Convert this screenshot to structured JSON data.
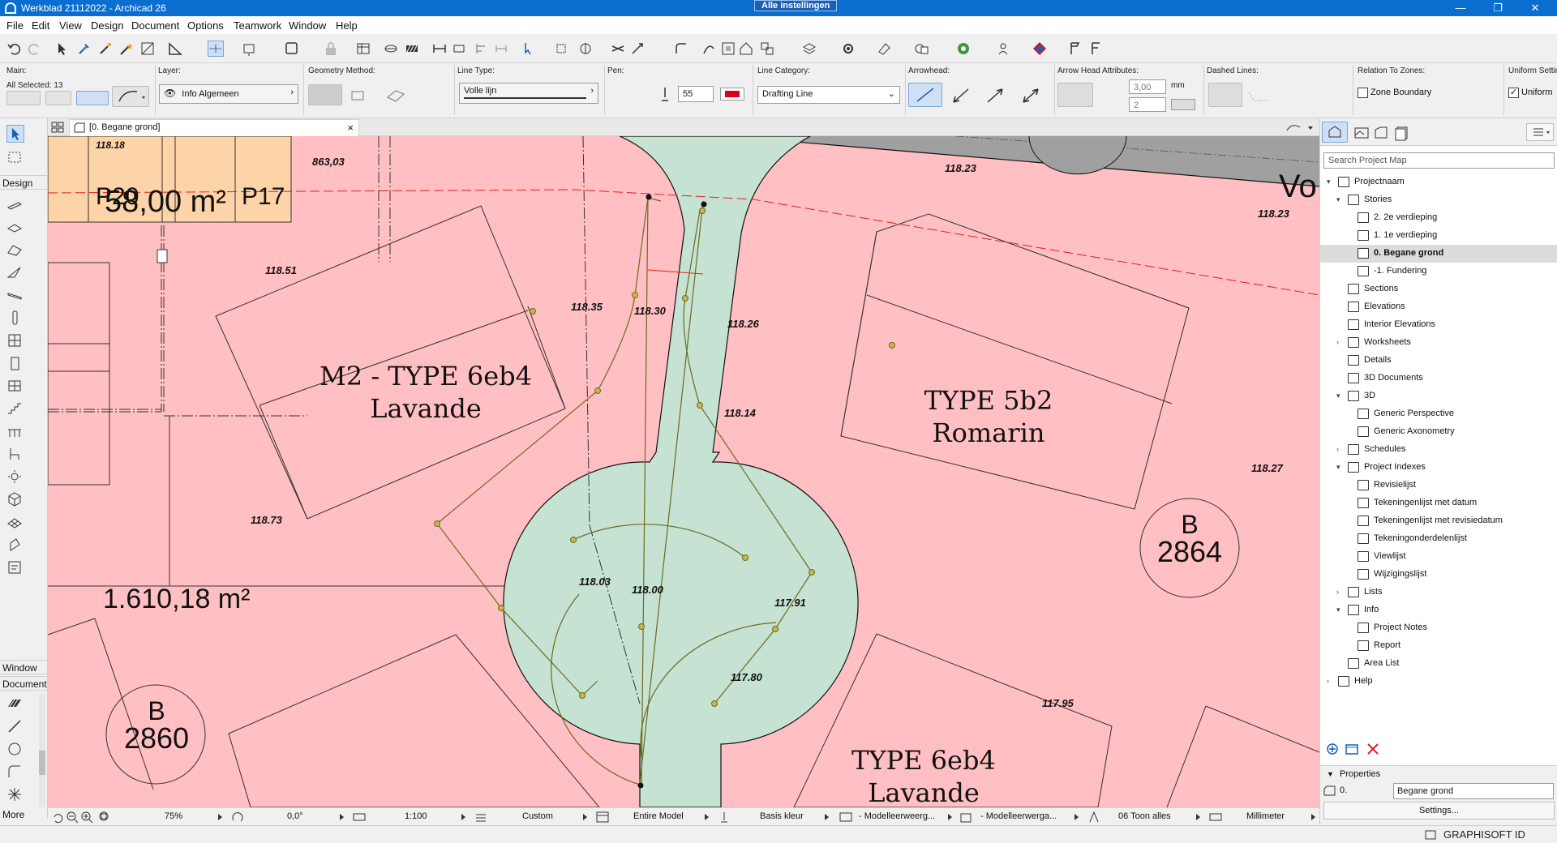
{
  "titlebar": {
    "title": "Werkblad 21112022 - Archicad 26",
    "settings_badge": "Alle instellingen",
    "minimize": "—",
    "maximize": "❐",
    "close": "✕"
  },
  "menu": [
    "File",
    "Edit",
    "View",
    "Design",
    "Document",
    "Options",
    "Teamwork",
    "Window",
    "Help"
  ],
  "infobox": {
    "main_label": "Main:",
    "all_selected": "All Selected: 13",
    "layer_label": "Layer:",
    "layer_value": "Info Algemeen",
    "geometry_label": "Geometry Method:",
    "linetype_label": "Line Type:",
    "linetype_value": "Volle lijn",
    "pen_label": "Pen:",
    "pen_value": "55",
    "pen_color": "#d9001b",
    "linecat_label": "Line Category:",
    "linecat_value": "Drafting Line",
    "arrowhead_label": "Arrowhead:",
    "arrow_attr_label": "Arrow Head Attributes:",
    "arrow_size": "3,00",
    "arrow_unit": "mm",
    "arrow_pen": "2",
    "dashed_label": "Dashed Lines:",
    "zones_label": "Relation To Zones:",
    "zone_boundary": "Zone Boundary",
    "uniform_label": "Uniform Setting",
    "uniform_value": "Uniform"
  },
  "toolbox": {
    "design_label": "Design",
    "window_label": "Window",
    "document_label": "Document",
    "more_label": "More"
  },
  "tab": {
    "label": "[0. Begane grond]",
    "close": "×"
  },
  "canvas": {
    "labels": {
      "p20": "P20",
      "area1": "58,00 m²",
      "p17": "P17",
      "h1": "118.18",
      "h2": "863,03",
      "h3": "118.51",
      "h4": "118.35",
      "h5": "118.30",
      "h6": "118.26",
      "h7": "118.23",
      "h8": "118.23",
      "vo": "Vo",
      "type1_line1": "M2 - TYPE 6eb4",
      "type1_line2": "Lavande",
      "type2_line1": "TYPE 5b2",
      "type2_line2": "Romarin",
      "h9": "118.14",
      "h10": "118.27",
      "b2864_b": "B",
      "b2864_n": "2864",
      "h11": "118.73",
      "area2": "1.610,18 m²",
      "h12": "118.03",
      "h13": "118.00",
      "h14": "117.91",
      "h15": "117.80",
      "h16": "117.95",
      "b2860_b": "B",
      "b2860_n": "2860",
      "type3_line1": "TYPE 6eb4",
      "type3_line2": "Lavande"
    },
    "colors": {
      "plot_pink": "#ffbfc3",
      "road_green": "#c5e2d3",
      "orange": "#fdd3a8",
      "gray": "#a0a0a0",
      "olive": "#6b6b1f",
      "red_dash": "#e02020"
    }
  },
  "statusbar": {
    "zoom": "75%",
    "angle": "0,0°",
    "scale": "1:100",
    "structure": "Custom",
    "model": "Entire Model",
    "pen_set": "Basis kleur",
    "view1": "- Modelleerweerg...",
    "view2": "- Modelleerwerga...",
    "renovation": "06 Toon alles",
    "units": "Millimeter"
  },
  "navigator": {
    "search_placeholder": "Search Project Map",
    "items": [
      {
        "label": "Projectnaam",
        "depth": 0,
        "exp": "▾"
      },
      {
        "label": "Stories",
        "depth": 1,
        "exp": "▾"
      },
      {
        "label": "2. 2e verdieping",
        "depth": 2,
        "exp": ""
      },
      {
        "label": "1. 1e verdieping",
        "depth": 2,
        "exp": ""
      },
      {
        "label": "0. Begane grond",
        "depth": 2,
        "exp": "",
        "selected": true
      },
      {
        "label": "-1. Fundering",
        "depth": 2,
        "exp": ""
      },
      {
        "label": "Sections",
        "depth": 1,
        "exp": ""
      },
      {
        "label": "Elevations",
        "depth": 1,
        "exp": ""
      },
      {
        "label": "Interior Elevations",
        "depth": 1,
        "exp": ""
      },
      {
        "label": "Worksheets",
        "depth": 1,
        "exp": "›"
      },
      {
        "label": "Details",
        "depth": 1,
        "exp": ""
      },
      {
        "label": "3D Documents",
        "depth": 1,
        "exp": ""
      },
      {
        "label": "3D",
        "depth": 1,
        "exp": "▾"
      },
      {
        "label": "Generic Perspective",
        "depth": 2,
        "exp": ""
      },
      {
        "label": "Generic Axonometry",
        "depth": 2,
        "exp": ""
      },
      {
        "label": "Schedules",
        "depth": 1,
        "exp": "›"
      },
      {
        "label": "Project Indexes",
        "depth": 1,
        "exp": "▾"
      },
      {
        "label": "Revisielijst",
        "depth": 2,
        "exp": ""
      },
      {
        "label": "Tekeningenlijst met datum",
        "depth": 2,
        "exp": ""
      },
      {
        "label": "Tekeningenlijst met revisiedatum",
        "depth": 2,
        "exp": ""
      },
      {
        "label": "Tekeningonderdelenlijst",
        "depth": 2,
        "exp": ""
      },
      {
        "label": "Viewlijst",
        "depth": 2,
        "exp": ""
      },
      {
        "label": "Wijzigingslijst",
        "depth": 2,
        "exp": ""
      },
      {
        "label": "Lists",
        "depth": 1,
        "exp": "›"
      },
      {
        "label": "Info",
        "depth": 1,
        "exp": "▾"
      },
      {
        "label": "Project Notes",
        "depth": 2,
        "exp": ""
      },
      {
        "label": "Report",
        "depth": 2,
        "exp": ""
      },
      {
        "label": "Area List",
        "depth": 1,
        "exp": ""
      },
      {
        "label": "Help",
        "depth": 0,
        "exp": "›"
      }
    ],
    "properties_label": "Properties",
    "prop_id": "0.",
    "prop_name": "Begane grond",
    "settings_button": "Settings..."
  },
  "footer": {
    "graphisoft_id": "GRAPHISOFT ID"
  }
}
